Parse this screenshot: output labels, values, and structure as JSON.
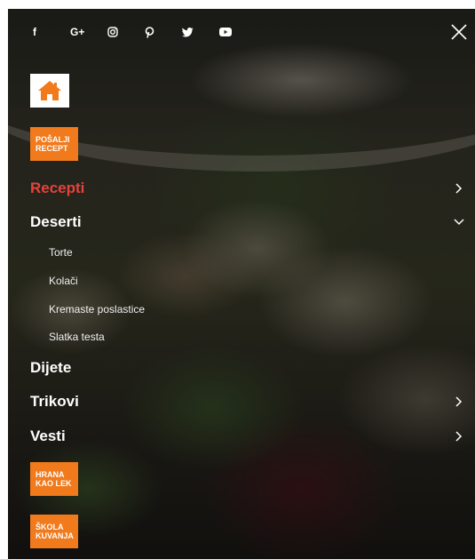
{
  "social": [
    {
      "icon": "facebook-icon",
      "glyph": "f"
    },
    {
      "icon": "google-plus-icon",
      "glyph": "G+"
    },
    {
      "icon": "instagram-icon",
      "glyph": ""
    },
    {
      "icon": "pinterest-icon",
      "glyph": ""
    },
    {
      "icon": "twitter-icon",
      "glyph": ""
    },
    {
      "icon": "youtube-icon",
      "glyph": ""
    }
  ],
  "colors": {
    "accent": "#f07a1c",
    "active": "#e4433a",
    "text": "#ffffff"
  },
  "buttons": {
    "send_recipe": "POŠALJI\nRECEPT",
    "food_as_medicine": "HRANA\nKAO LEK",
    "cooking_school": "ŠKOLA\nKUVANJA"
  },
  "menu": {
    "recepti": "Recepti",
    "deserti": "Deserti",
    "deserti_sub": [
      "Torte",
      "Kolači",
      "Kremaste poslastice",
      "Slatka testa"
    ],
    "dijete": "Dijete",
    "trikovi": "Trikovi",
    "vesti": "Vesti"
  }
}
